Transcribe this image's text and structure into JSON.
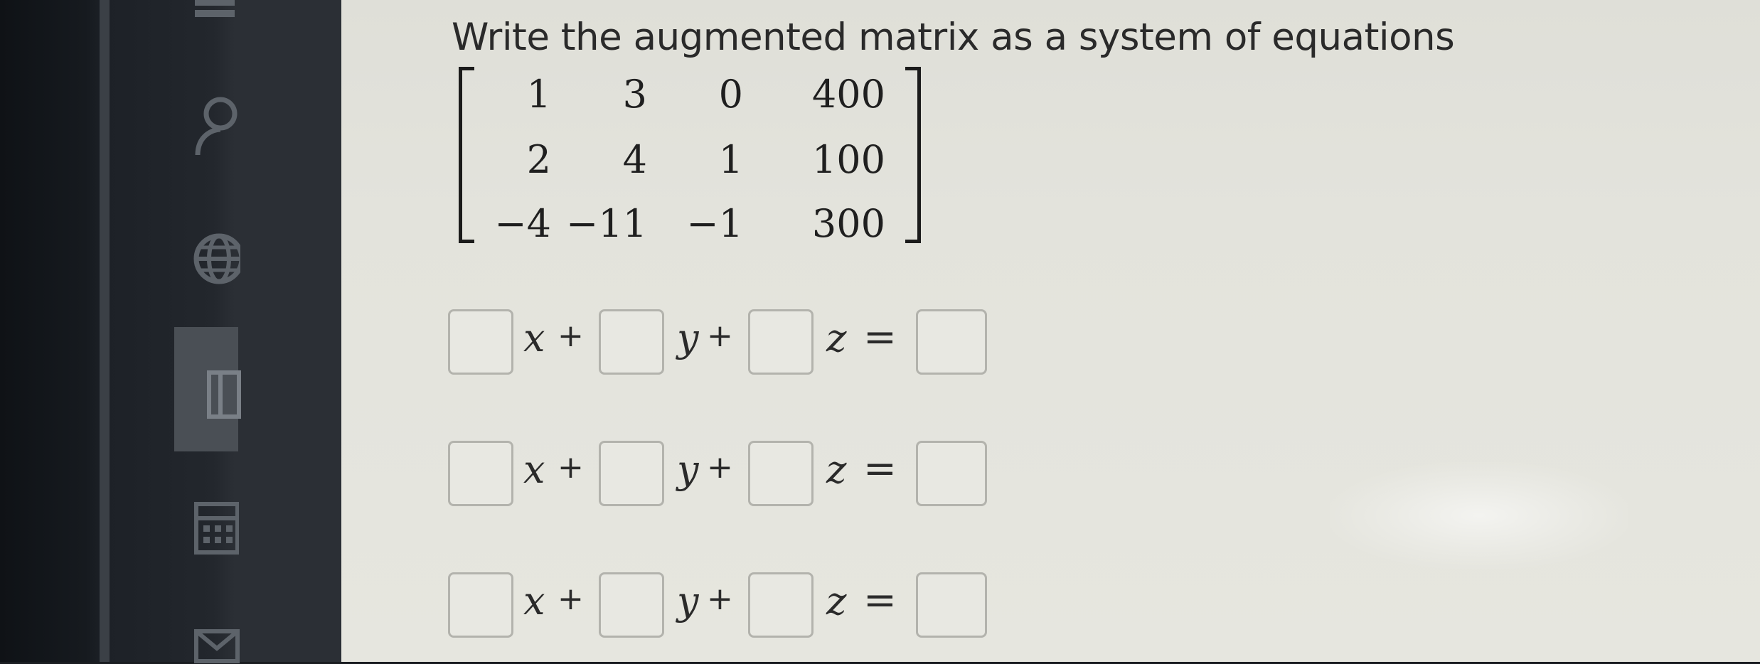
{
  "question": {
    "title": "Write the augmented matrix as a system of equations"
  },
  "matrix": {
    "rows": [
      [
        "1",
        "3",
        "0",
        "400"
      ],
      [
        "2",
        "4",
        "1",
        "100"
      ],
      [
        "−4",
        "−11",
        "−1",
        "300"
      ]
    ]
  },
  "equations": {
    "variables": [
      "x",
      "y",
      "z"
    ],
    "plus": "+",
    "equals": "=",
    "rows": [
      {
        "x_coef": "",
        "y_coef": "",
        "z_coef": "",
        "rhs": ""
      },
      {
        "x_coef": "",
        "y_coef": "",
        "z_coef": "",
        "rhs": ""
      },
      {
        "x_coef": "",
        "y_coef": "",
        "z_coef": "",
        "rhs": ""
      }
    ]
  },
  "sidebar": {
    "icons": [
      "inbox-icon",
      "user-icon",
      "globe-icon",
      "book-icon",
      "calendar-icon",
      "mail-icon"
    ]
  },
  "colors": {
    "page_background": "#e3e3dc",
    "sidebar_background": "#2b2f35",
    "input_border": "#b3b3ad",
    "text": "#2a2a2a"
  }
}
